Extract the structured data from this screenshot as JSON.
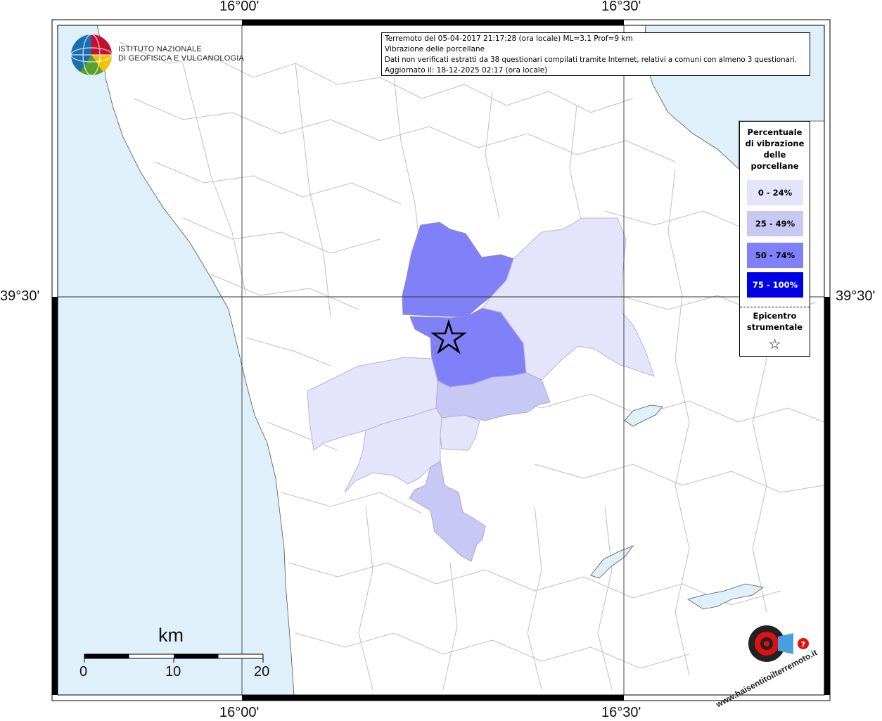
{
  "info": {
    "line1": "Terremoto del 05-04-2017 21:17:28 (ora locale) ML=3.1 Prof=9 km",
    "line2": "Vibrazione delle porcellane",
    "line3": "Dati non verificati estratti da 38 questionari compilati tramite Internet, relativi a comuni con almeno 3 questionari.",
    "line4": "Aggiornato il: 18-12-2025 02:17 (ora locale)"
  },
  "coords": {
    "lon_left": "16°00'",
    "lon_right": "16°30'",
    "lat": "39°30'"
  },
  "logo": {
    "line1": "ISTITUTO NAZIONALE",
    "line2": "DI GEOFISICA E VULCANOLOGIA"
  },
  "legend": {
    "title_lines": [
      "Percentuale",
      "di vibrazione",
      "delle",
      "porcellane"
    ],
    "items": [
      {
        "label": "0 - 24%",
        "color": "#e4e4fa"
      },
      {
        "label": "25 - 49%",
        "color": "#c8c8f5"
      },
      {
        "label": "50 - 74%",
        "color": "#8080f8"
      },
      {
        "label": "75 - 100%",
        "color": "#0000e6"
      }
    ],
    "epicenter_lines": [
      "Epicentro",
      "strumentale"
    ],
    "epicenter_symbol": "☆"
  },
  "scale": {
    "unit": "km",
    "ticks": [
      "0",
      "10",
      "20"
    ]
  },
  "brand": {
    "text": "www.haisentitoilterremoto.it"
  },
  "colors": {
    "sea": "#dff0fb",
    "land": "#ffffff",
    "border": "#b8b8b8"
  }
}
